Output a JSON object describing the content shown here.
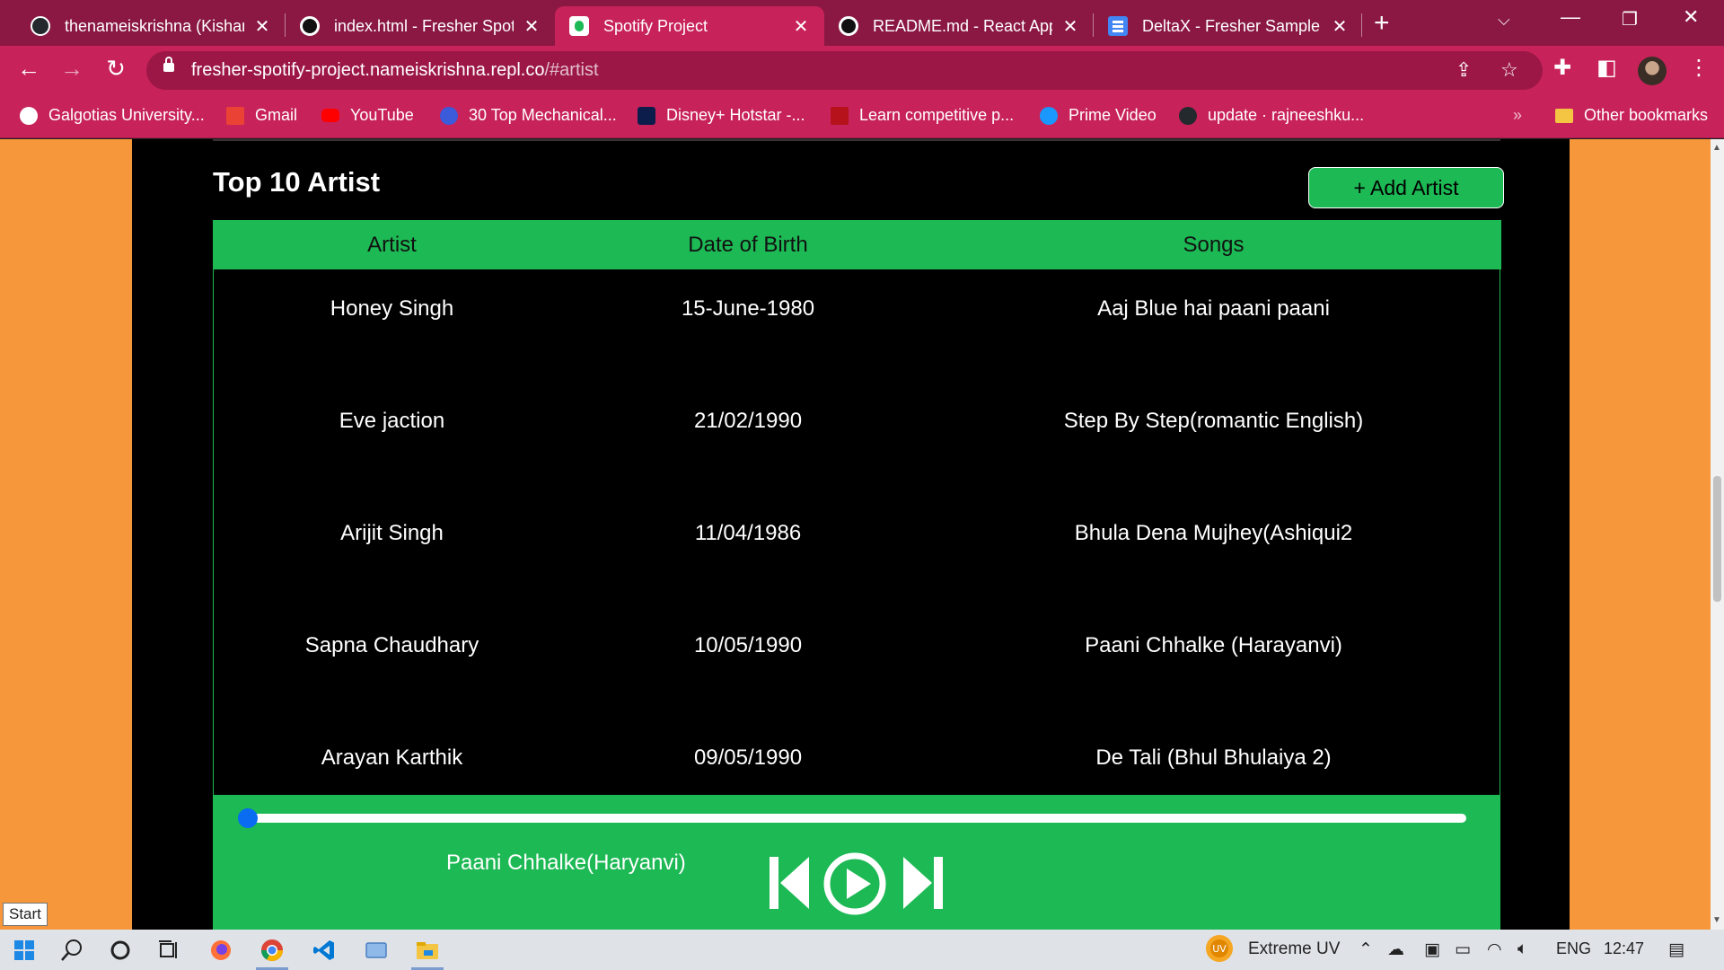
{
  "browser": {
    "tabs": [
      {
        "title": "thenameiskrishna (Kishan",
        "icon": "github-icon",
        "active": false
      },
      {
        "title": "index.html - Fresher Spoti",
        "icon": "replit-icon",
        "active": false
      },
      {
        "title": "Spotify Project",
        "icon": "spotify-icon",
        "active": true
      },
      {
        "title": "README.md - React App",
        "icon": "replit-icon",
        "active": false
      },
      {
        "title": "DeltaX - Fresher Sample A",
        "icon": "docs-icon",
        "active": false
      }
    ],
    "url_host": "fresher-spotify-project.nameiskrishna.repl.co",
    "url_path": "/#artist",
    "bookmarks": [
      {
        "label": "Galgotias University...",
        "icon": "chrome-globe-icon",
        "color": "#ffffff"
      },
      {
        "label": "Gmail",
        "icon": "gmail-icon",
        "color": "#ea4335"
      },
      {
        "label": "YouTube",
        "icon": "youtube-icon",
        "color": "#ff0000"
      },
      {
        "label": "30 Top Mechanical...",
        "icon": "gear-bookmark-icon",
        "color": "#3b5bdb"
      },
      {
        "label": "Disney+ Hotstar -...",
        "icon": "hotstar-icon",
        "color": "#0c1d4c"
      },
      {
        "label": "Learn competitive p...",
        "icon": "book-icon",
        "color": "#b5121b"
      },
      {
        "label": "Prime Video",
        "icon": "prime-video-icon",
        "color": "#1a98ff"
      },
      {
        "label": "update · rajneeshku...",
        "icon": "github-icon",
        "color": "#24292e"
      }
    ],
    "other_bookmarks": "Other bookmarks"
  },
  "app": {
    "heading": "Top 10 Artist",
    "add_button": "+ Add Artist",
    "columns": [
      "Artist",
      "Date of Birth",
      "Songs"
    ],
    "rows": [
      {
        "artist": "Honey Singh",
        "dob": "15-June-1980",
        "songs": "Aaj Blue hai paani paani"
      },
      {
        "artist": "Eve jaction",
        "dob": "21/02/1990",
        "songs": "Step By Step(romantic English)"
      },
      {
        "artist": "Arijit Singh",
        "dob": "11/04/1986",
        "songs": "Bhula Dena Mujhey(Ashiqui2"
      },
      {
        "artist": "Sapna Chaudhary",
        "dob": "10/05/1990",
        "songs": "Paani Chhalke (Harayanvi)"
      },
      {
        "artist": "Arayan Karthik",
        "dob": "09/05/1990",
        "songs": "De Tali (Bhul Bhulaiya 2)"
      }
    ],
    "player": {
      "now_playing": "Paani Chhalke(Haryanvi)",
      "progress": 0.0
    }
  },
  "colors": {
    "chrome_dark": "#8a1842",
    "chrome": "#c8225a",
    "page_bg": "#f5973a",
    "spotify_green": "#1db954"
  },
  "taskbar": {
    "start_tooltip": "Start",
    "weather": "Extreme UV",
    "weather_badge": "UV",
    "language": "ENG",
    "time": "12:47"
  }
}
